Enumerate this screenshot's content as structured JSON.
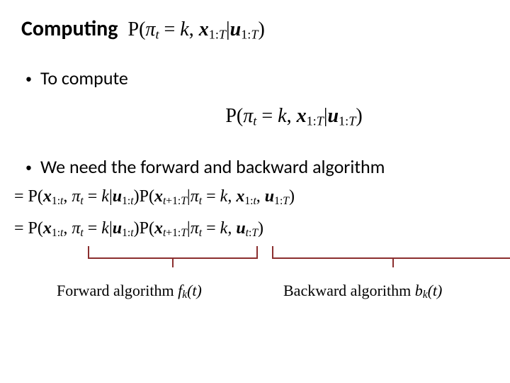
{
  "title": {
    "word": "Computing",
    "formula": "P(π_t = k, x_{1:T} | u_{1:T})"
  },
  "bullets": {
    "b1": "To compute",
    "center_formula": "P(π_t = k, x_{1:T} | u_{1:T})",
    "b2": "We need the forward and backward algorithm"
  },
  "equations": {
    "line1": "= P(x_{1:t}, π_t = k | u_{1:t}) P(x_{t+1:T} | π_t = k, x_{1:t}, u_{1:T})",
    "line2": "= P(x_{1:t}, π_t = k | u_{1:t}) P(x_{t+1:T} | π_t = k, u_{t:T})"
  },
  "labels": {
    "forward_text": "Forward algorithm ",
    "forward_sym": "f",
    "forward_sub": "k",
    "forward_arg": "(t)",
    "backward_text": "Backward algorithm ",
    "backward_sym": "b",
    "backward_sub": "k",
    "backward_arg": "(t)"
  }
}
